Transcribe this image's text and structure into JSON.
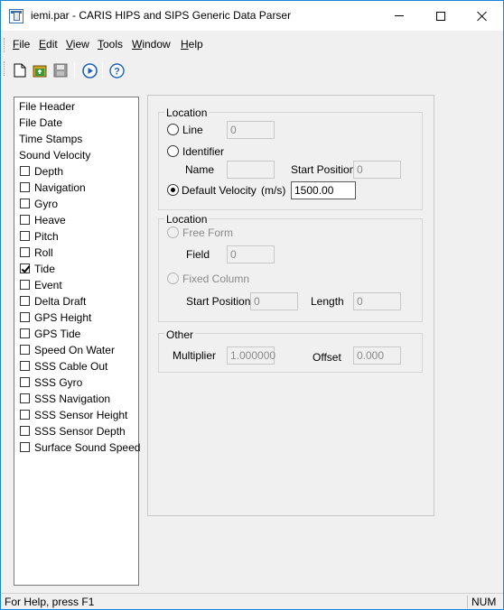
{
  "window": {
    "title": "iemi.par - CARIS HIPS and SIPS Generic Data Parser"
  },
  "menu": [
    {
      "label": "File",
      "accel": "F",
      "rest": "ile"
    },
    {
      "label": "Edit",
      "accel": "E",
      "rest": "dit"
    },
    {
      "label": "View",
      "accel": "V",
      "rest": "iew"
    },
    {
      "label": "Tools",
      "accel": "T",
      "rest": "ools"
    },
    {
      "label": "Window",
      "accel": "W",
      "rest": "indow"
    },
    {
      "label": "Help",
      "accel": "H",
      "rest": "elp"
    }
  ],
  "toolbar": {
    "icons": [
      "new-file-icon",
      "open-file-icon",
      "save-icon",
      "run-icon",
      "help-icon"
    ]
  },
  "tree": {
    "headers": [
      "File Header",
      "File Date",
      "Time Stamps",
      "Sound Velocity"
    ],
    "items": [
      {
        "label": "Depth",
        "checked": false
      },
      {
        "label": "Navigation",
        "checked": false
      },
      {
        "label": "Gyro",
        "checked": false
      },
      {
        "label": "Heave",
        "checked": false
      },
      {
        "label": "Pitch",
        "checked": false
      },
      {
        "label": "Roll",
        "checked": false
      },
      {
        "label": "Tide",
        "checked": true
      },
      {
        "label": "Event",
        "checked": false
      },
      {
        "label": "Delta Draft",
        "checked": false
      },
      {
        "label": "GPS Height",
        "checked": false
      },
      {
        "label": "GPS Tide",
        "checked": false
      },
      {
        "label": "Speed On Water",
        "checked": false
      },
      {
        "label": "SSS Cable Out",
        "checked": false
      },
      {
        "label": "SSS Gyro",
        "checked": false
      },
      {
        "label": "SSS Navigation",
        "checked": false
      },
      {
        "label": "SSS Sensor Height",
        "checked": false
      },
      {
        "label": "SSS Sensor Depth",
        "checked": false
      },
      {
        "label": "Surface Sound Speed",
        "checked": false
      }
    ]
  },
  "location1": {
    "legend": "Location",
    "line_label": "Line",
    "line_value": "0",
    "identifier_label": "Identifier",
    "name_label": "Name",
    "name_value": "",
    "start_position_label": "Start Position",
    "start_position_value": "0",
    "default_velocity_label": "Default Velocity",
    "units": "(m/s)",
    "default_velocity_value": "1500.00",
    "selected": "Default Velocity"
  },
  "location2": {
    "legend": "Location",
    "free_form_label": "Free Form",
    "field_label": "Field",
    "field_value": "0",
    "fixed_column_label": "Fixed Column",
    "start_position_label": "Start Position",
    "start_position_value": "0",
    "length_label": "Length",
    "length_value": "0"
  },
  "other": {
    "legend": "Other",
    "multiplier_label": "Multiplier",
    "multiplier_value": "1.000000",
    "offset_label": "Offset",
    "offset_value": "0.000"
  },
  "status": {
    "help_text": "For Help, press F1",
    "indicator": "NUM"
  }
}
